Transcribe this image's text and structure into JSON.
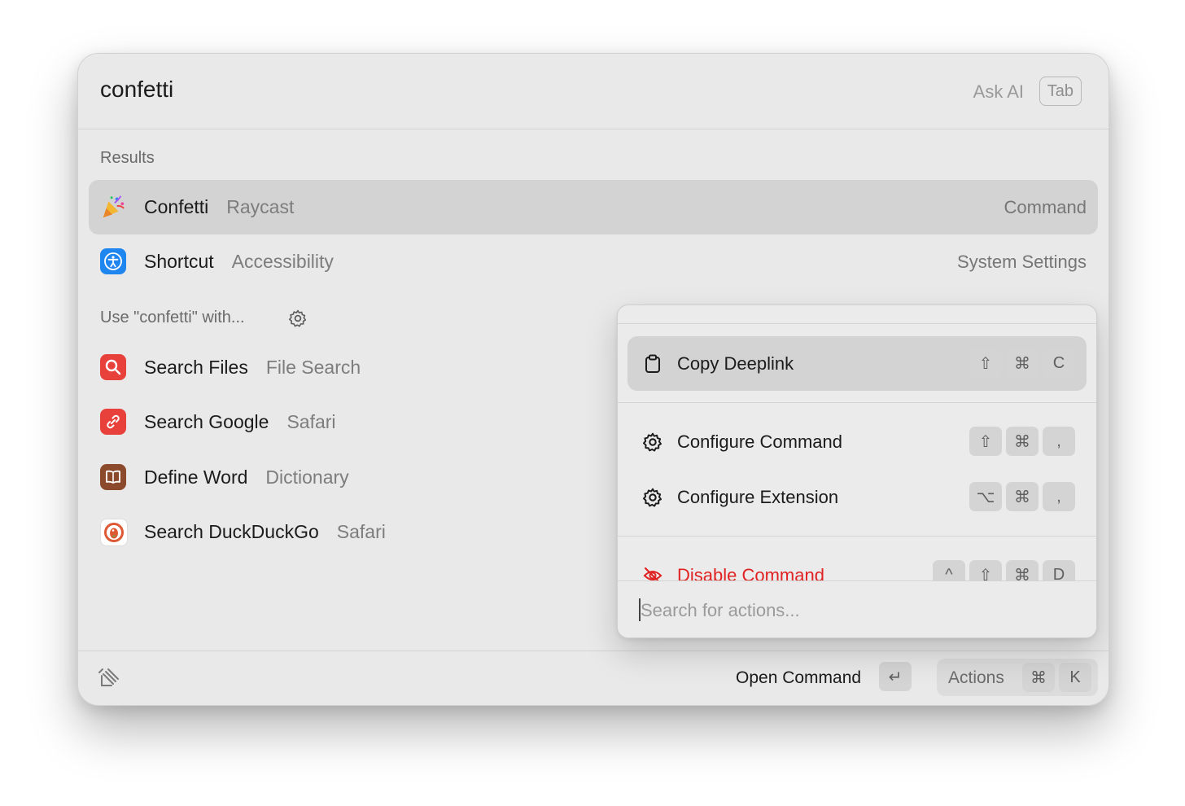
{
  "search": {
    "query": "confetti",
    "ask_ai_label": "Ask AI",
    "tab_key": "Tab"
  },
  "results": {
    "header": "Results",
    "items": [
      {
        "title": "Confetti",
        "subtitle": "Raycast",
        "accessory": "Command",
        "icon": "party-popper-icon",
        "selected": true
      },
      {
        "title": "Shortcut",
        "subtitle": "Accessibility",
        "accessory": "System Settings",
        "icon": "accessibility-icon",
        "selected": false
      }
    ]
  },
  "fallback": {
    "header": "Use \"confetti\" with...",
    "settings_icon": "gear-icon",
    "items": [
      {
        "title": "Search Files",
        "subtitle": "File Search",
        "icon": "magnifier-icon",
        "color": "#e8403a"
      },
      {
        "title": "Search Google",
        "subtitle": "Safari",
        "icon": "link-icon",
        "color": "#e8403a"
      },
      {
        "title": "Define Word",
        "subtitle": "Dictionary",
        "icon": "book-icon",
        "color": "#8b4a2b"
      },
      {
        "title": "Search DuckDuckGo",
        "subtitle": "Safari",
        "icon": "duckduckgo-icon",
        "color": "#de5833"
      }
    ]
  },
  "footer": {
    "logo": "raycast-logo-icon",
    "primary_action": "Open Command",
    "enter_key": "↵",
    "actions_label": "Actions",
    "actions_keys": [
      "⌘",
      "K"
    ]
  },
  "actions_panel": {
    "items": [
      {
        "label": "Copy Deeplink",
        "icon": "clipboard-icon",
        "keys": [
          "⇧",
          "⌘",
          "C"
        ],
        "selected": true,
        "danger": false
      },
      {
        "label": "Configure Command",
        "icon": "gear-icon",
        "keys": [
          "⇧",
          "⌘",
          ","
        ],
        "selected": false,
        "danger": false
      },
      {
        "label": "Configure Extension",
        "icon": "gear-icon",
        "keys": [
          "⌥",
          "⌘",
          ","
        ],
        "selected": false,
        "danger": false
      },
      {
        "label": "Disable Command",
        "icon": "eye-slash-icon",
        "keys": [
          "^",
          "⇧",
          "⌘",
          "D"
        ],
        "selected": false,
        "danger": true
      }
    ],
    "search_placeholder": "Search for actions..."
  },
  "colors": {
    "accent_danger": "#e02222",
    "selection": "#d3d3d3",
    "window_bg": "#e9e9e9"
  }
}
